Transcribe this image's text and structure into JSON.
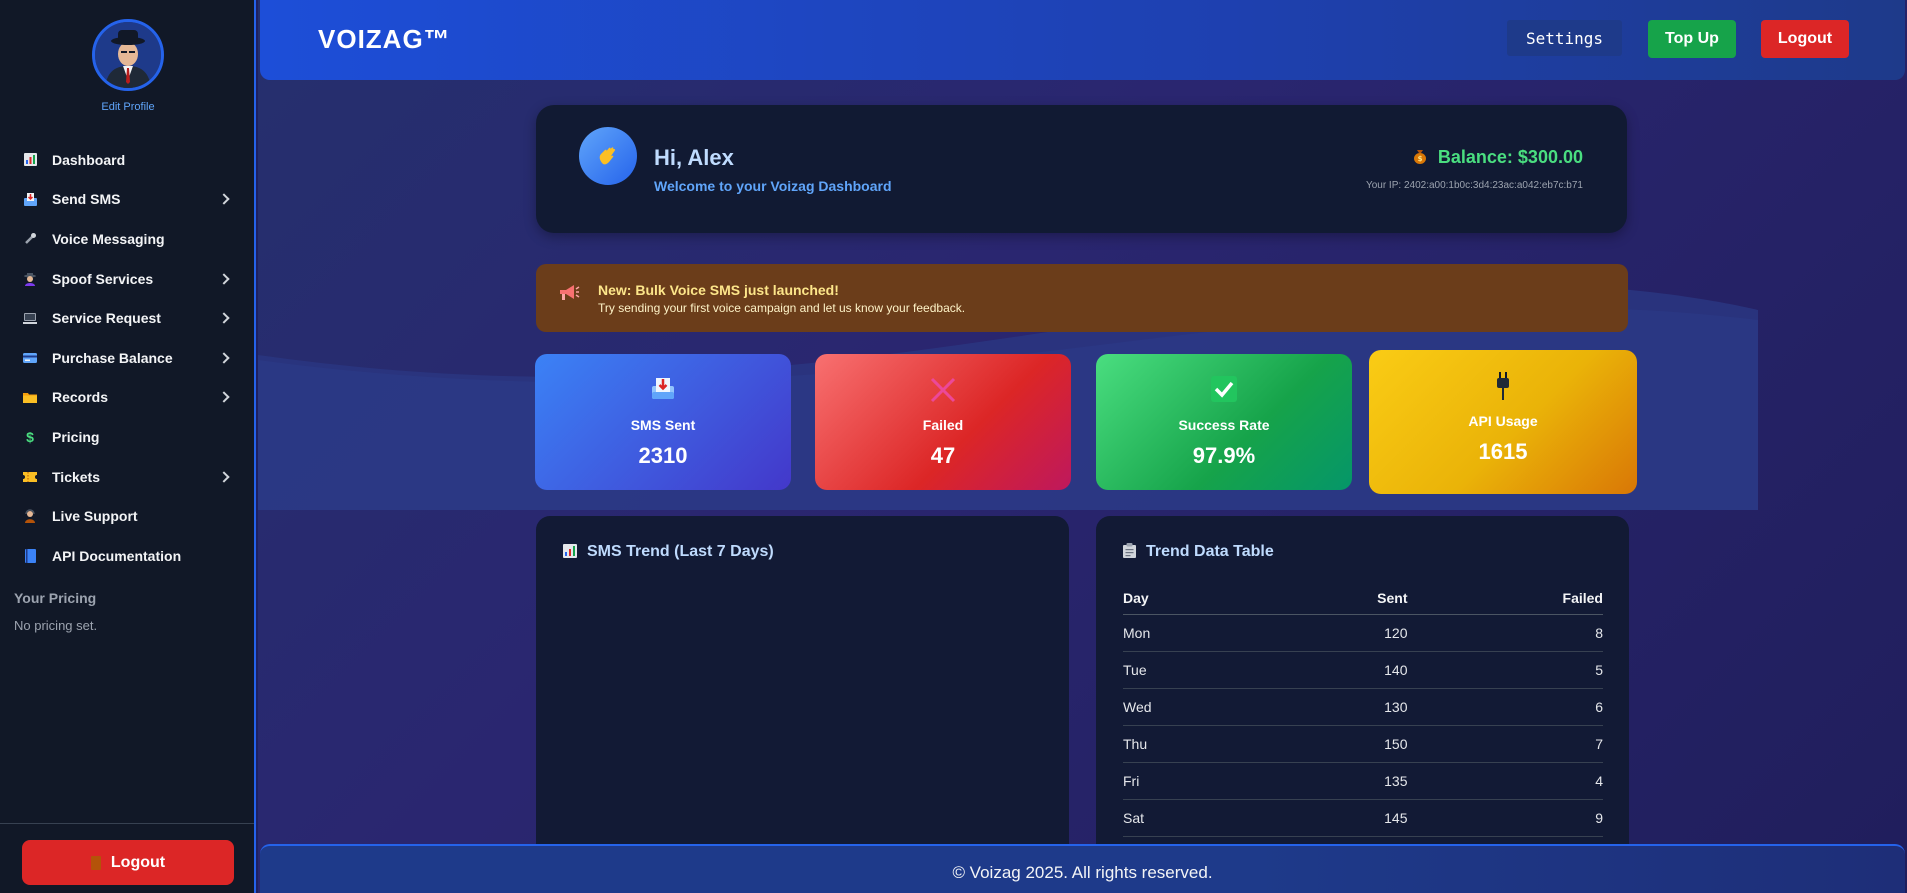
{
  "sidebar": {
    "edit_profile": "Edit Profile",
    "items": [
      {
        "label": "Dashboard",
        "icon": "bar-chart-icon"
      },
      {
        "label": "Send SMS",
        "icon": "inbox-tray-icon"
      },
      {
        "label": "Voice Messaging",
        "icon": "microphone-icon"
      },
      {
        "label": "Spoof Services",
        "icon": "spy-icon"
      },
      {
        "label": "Service Request",
        "icon": "computer-icon"
      },
      {
        "label": "Purchase Balance",
        "icon": "credit-card-icon"
      },
      {
        "label": "Records",
        "icon": "folder-icon"
      },
      {
        "label": "Pricing",
        "icon": "dollar-icon"
      },
      {
        "label": "Tickets",
        "icon": "ticket-icon"
      },
      {
        "label": "Live Support",
        "icon": "support-agent-icon"
      },
      {
        "label": "API Documentation",
        "icon": "book-icon"
      }
    ],
    "pricing_title": "Your Pricing",
    "pricing_note": "No pricing set.",
    "logout": "Logout"
  },
  "topbar": {
    "brand": "VOIZAG™",
    "settings": "Settings",
    "topup": "Top Up",
    "logout": "Logout"
  },
  "welcome": {
    "greeting": "Hi, Alex",
    "subtitle": "Welcome to your Voizag Dashboard",
    "balance": "Balance: $300.00",
    "ip": "Your IP: 2402:a00:1b0c:3d4:23ac:a042:eb7c:b71"
  },
  "announcement": {
    "title": "New: Bulk Voice SMS just launched!",
    "text": "Try sending your first voice campaign and let us know your feedback."
  },
  "stats": [
    {
      "label": "SMS Sent",
      "value": "2310",
      "icon": "inbox-tray-icon"
    },
    {
      "label": "Failed",
      "value": "47",
      "icon": "cross-icon"
    },
    {
      "label": "Success Rate",
      "value": "97.9%",
      "icon": "check-icon"
    },
    {
      "label": "API Usage",
      "value": "1615",
      "icon": "plug-icon"
    }
  ],
  "chart_panel": {
    "title": "SMS Trend (Last 7 Days)"
  },
  "table_panel": {
    "title": "Trend Data Table",
    "headers": [
      "Day",
      "Sent",
      "Failed"
    ],
    "rows": [
      [
        "Mon",
        "120",
        "8"
      ],
      [
        "Tue",
        "140",
        "5"
      ],
      [
        "Wed",
        "130",
        "6"
      ],
      [
        "Thu",
        "150",
        "7"
      ],
      [
        "Fri",
        "135",
        "4"
      ],
      [
        "Sat",
        "145",
        "9"
      ]
    ]
  },
  "footer": "© Voizag 2025. All rights reserved.",
  "colors": {
    "primary": "#2563eb",
    "success": "#16a34a",
    "danger": "#dc2626",
    "warning": "#eab308"
  }
}
